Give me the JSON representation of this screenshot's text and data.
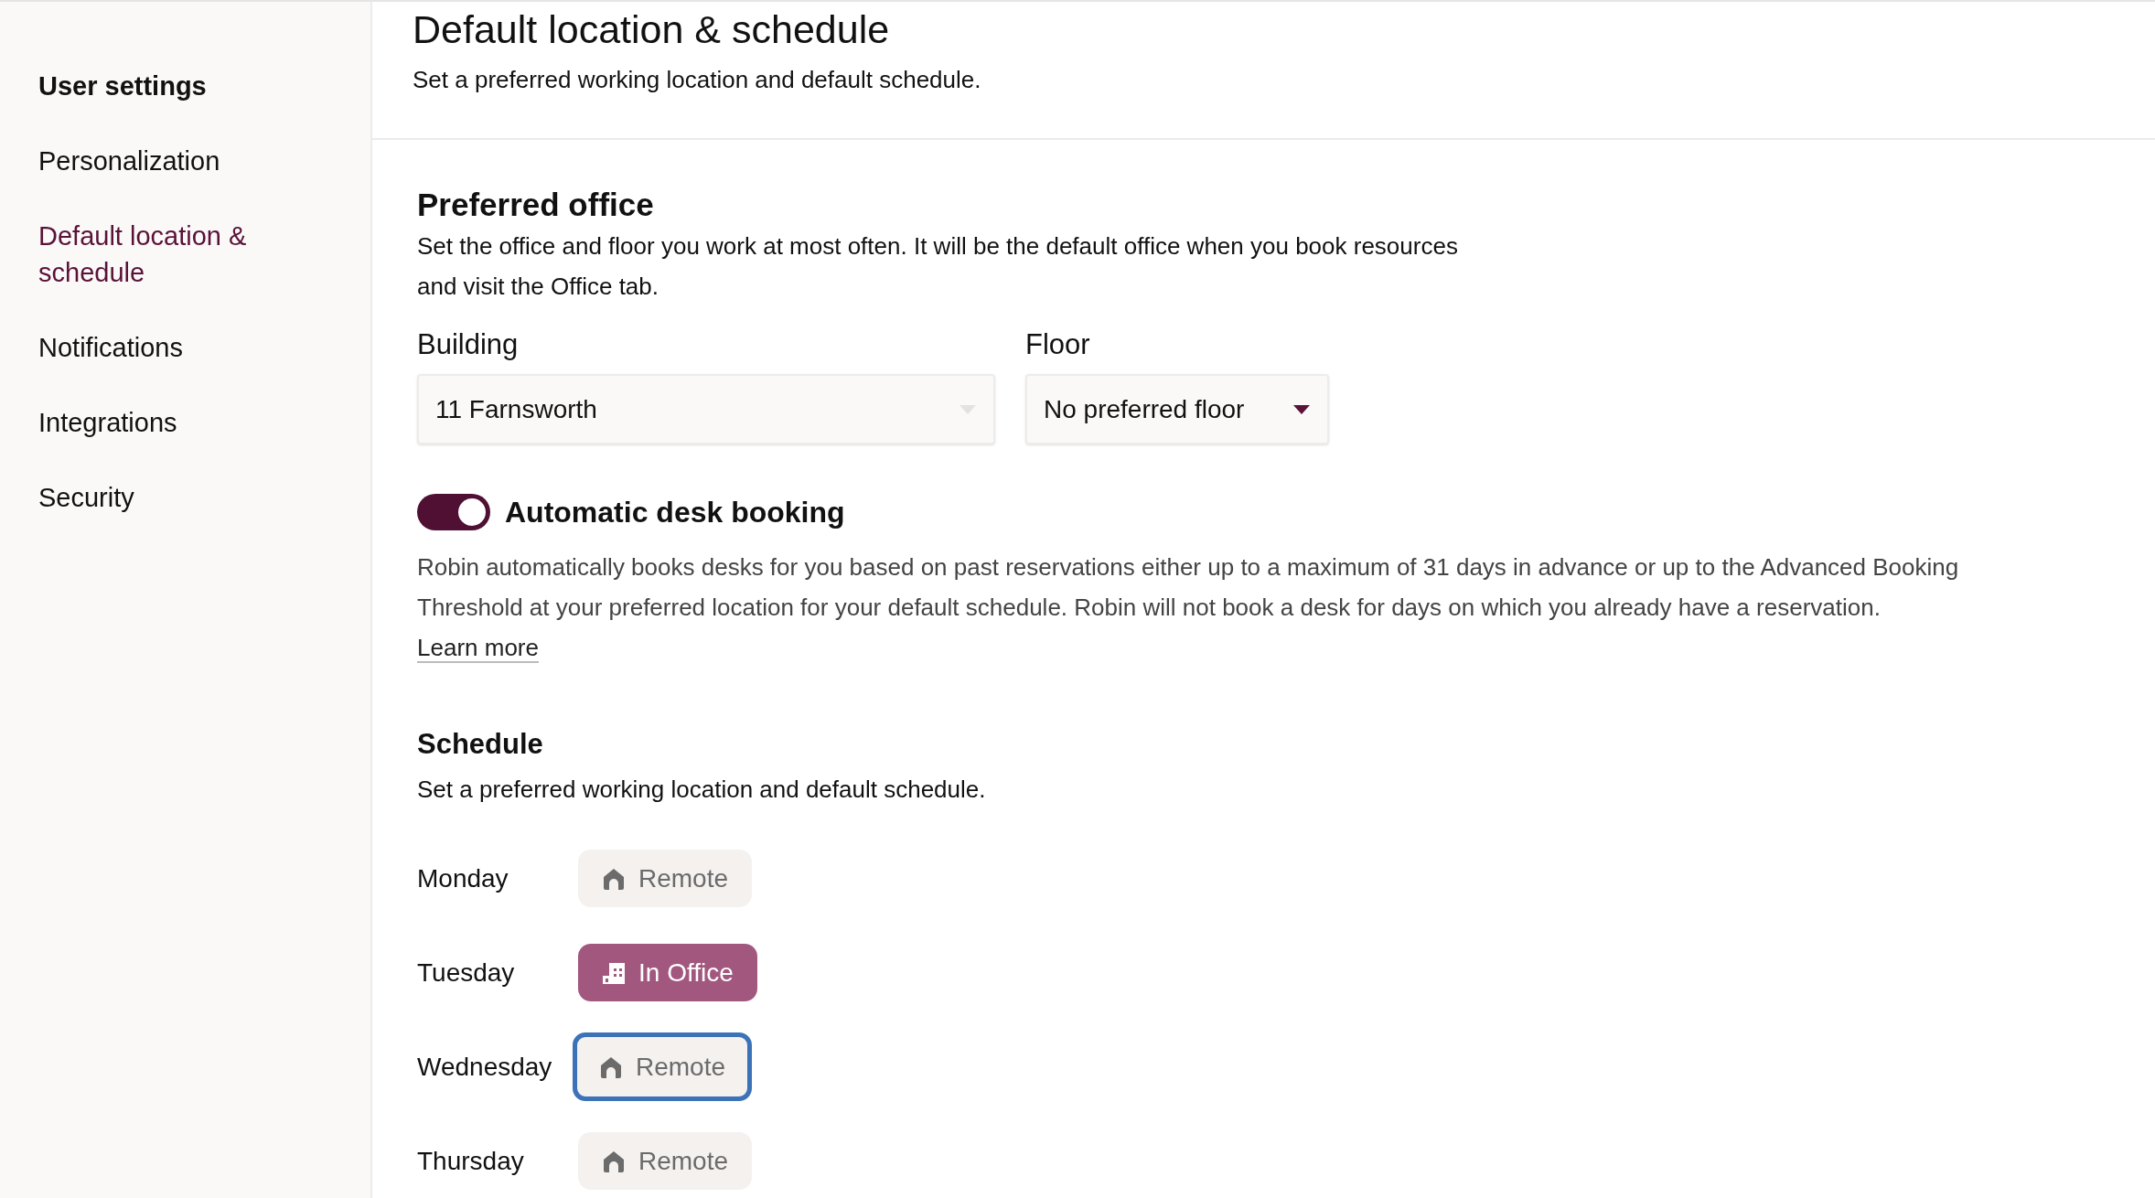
{
  "sidebar": {
    "items": [
      {
        "label": "User settings",
        "kind": "heading",
        "selected": false
      },
      {
        "label": "Personalization",
        "kind": "link",
        "selected": false
      },
      {
        "label": "Default location & schedule",
        "kind": "link",
        "selected": true
      },
      {
        "label": "Notifications",
        "kind": "link",
        "selected": false
      },
      {
        "label": "Integrations",
        "kind": "link",
        "selected": false
      },
      {
        "label": "Security",
        "kind": "link",
        "selected": false
      }
    ]
  },
  "header": {
    "title": "Default location & schedule",
    "subtitle": "Set a preferred working location and default schedule."
  },
  "preferred_office": {
    "title": "Preferred office",
    "description": "Set the office and floor you work at most often. It will be the default office when you book resources and visit the Office tab.",
    "building": {
      "label": "Building",
      "value": "11 Farnsworth",
      "disabled": true
    },
    "floor": {
      "label": "Floor",
      "value": "No preferred floor",
      "disabled": false
    }
  },
  "auto_booking": {
    "label": "Automatic desk booking",
    "on": true,
    "description": "Robin automatically books desks for you based on past reservations either up to a maximum of 31 days in advance or up to the Advanced Booking Threshold at your preferred location for your default schedule. Robin will not book a desk for days on which you already have a reservation.",
    "link": "Learn more"
  },
  "schedule": {
    "title": "Schedule",
    "subtitle": "Set a preferred working location and default schedule.",
    "days": [
      {
        "day": "Monday",
        "kind": "remote",
        "label": "Remote",
        "focused": false
      },
      {
        "day": "Tuesday",
        "kind": "office",
        "label": "In Office",
        "focused": false
      },
      {
        "day": "Wednesday",
        "kind": "remote",
        "label": "Remote",
        "focused": true
      },
      {
        "day": "Thursday",
        "kind": "remote",
        "label": "Remote",
        "focused": false
      }
    ]
  }
}
